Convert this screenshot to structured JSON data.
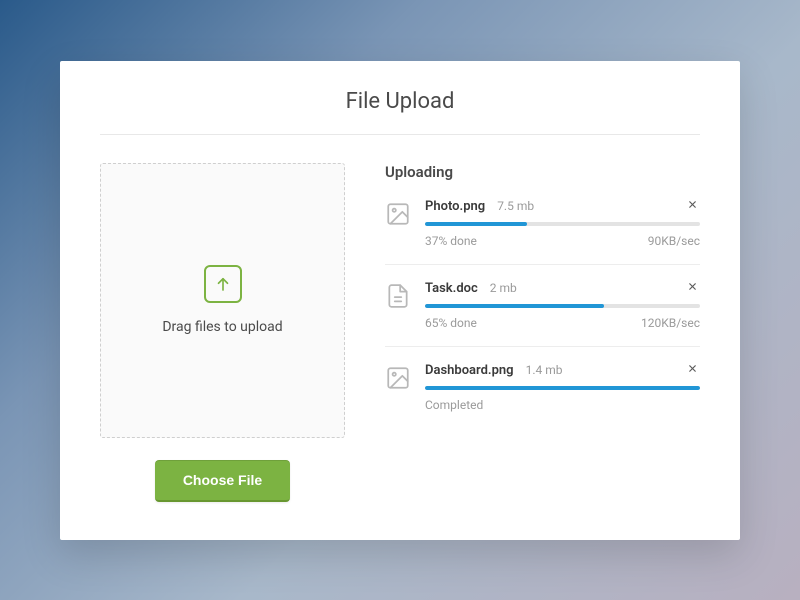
{
  "title": "File Upload",
  "dropzone": {
    "text": "Drag files to upload"
  },
  "choose_button": "Choose File",
  "uploading_heading": "Uploading",
  "files": [
    {
      "icon": "image",
      "name": "Photo.png",
      "size": "7.5 mb",
      "progress": 37,
      "status": "37% done",
      "speed": "90KB/sec"
    },
    {
      "icon": "document",
      "name": "Task.doc",
      "size": "2 mb",
      "progress": 65,
      "status": "65% done",
      "speed": "120KB/sec"
    },
    {
      "icon": "image",
      "name": "Dashboard.png",
      "size": "1.4 mb",
      "progress": 100,
      "status": "Completed",
      "speed": ""
    }
  ],
  "colors": {
    "accent_green": "#7cb342",
    "progress_blue": "#2196d6"
  }
}
